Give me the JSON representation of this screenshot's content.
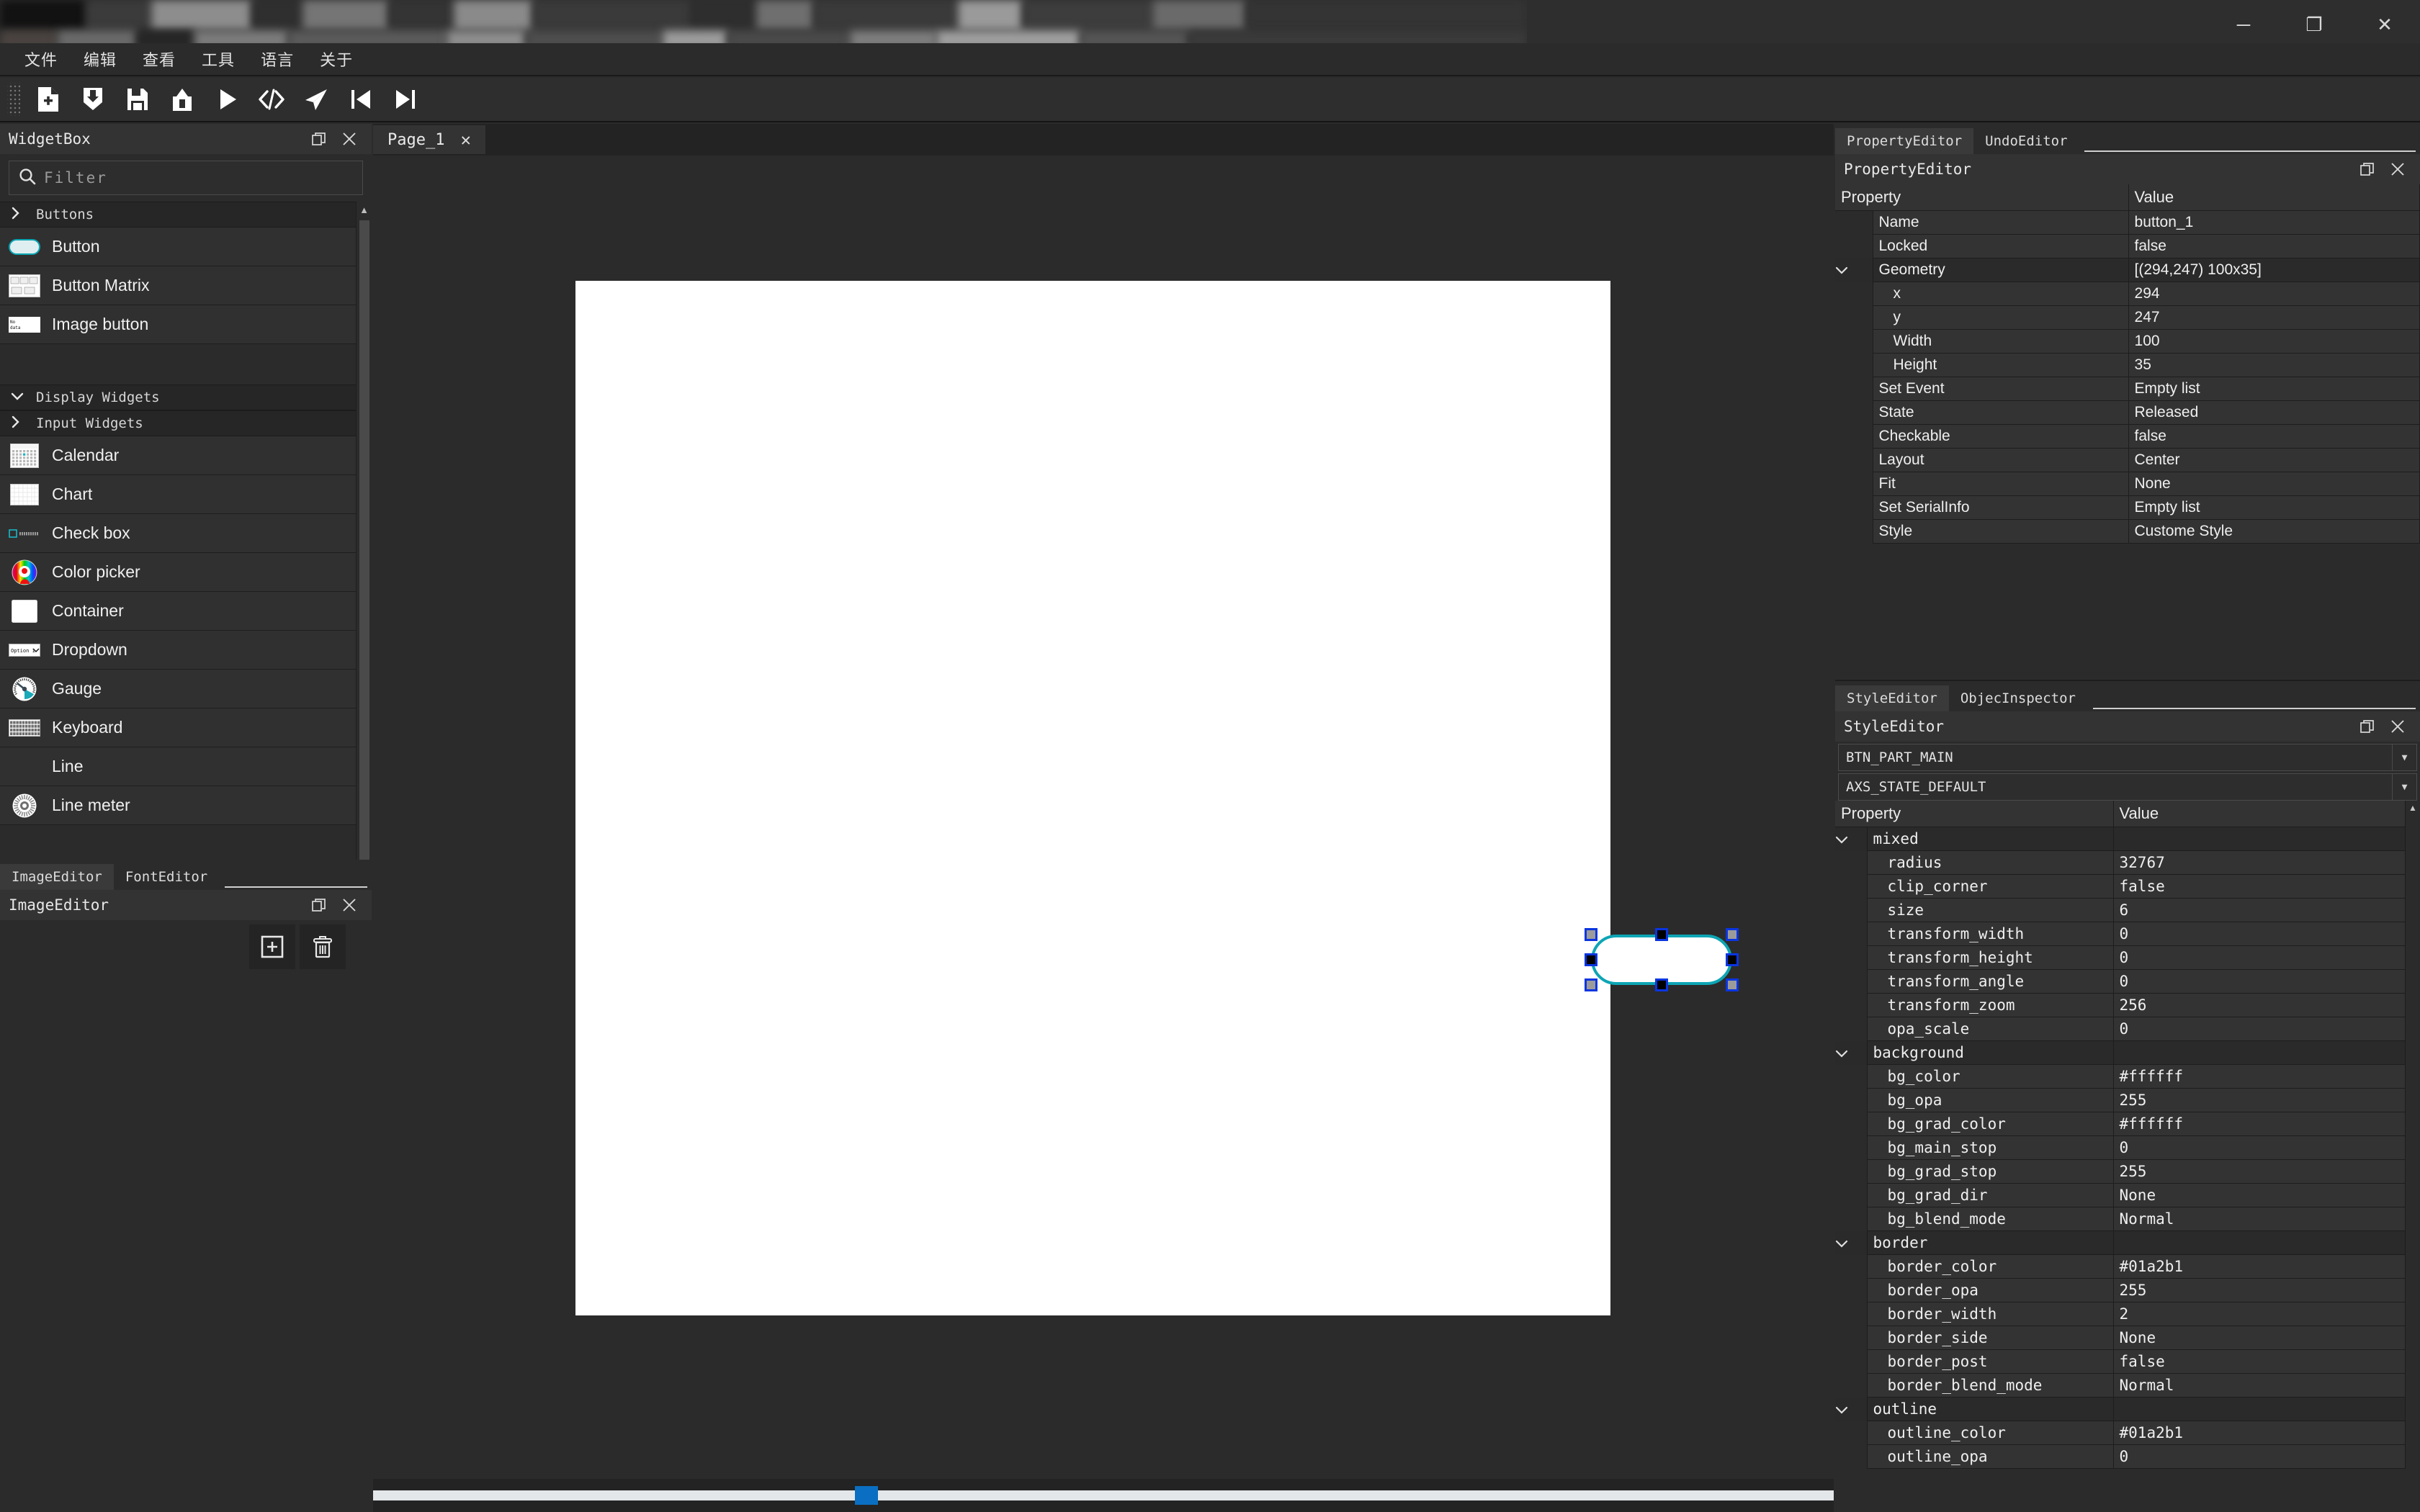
{
  "window": {
    "minimize_label": "─",
    "maximize_label": "❐",
    "close_label": "✕"
  },
  "menubar": {
    "items": [
      {
        "label": "文件",
        "name": "menu-file"
      },
      {
        "label": "编辑",
        "name": "menu-edit"
      },
      {
        "label": "查看",
        "name": "menu-view"
      },
      {
        "label": "工具",
        "name": "menu-tools"
      },
      {
        "label": "语言",
        "name": "menu-language"
      },
      {
        "label": "关于",
        "name": "menu-about"
      }
    ]
  },
  "toolbar": {
    "buttons": [
      {
        "icon": "new-file-icon"
      },
      {
        "icon": "open-file-icon"
      },
      {
        "icon": "save-icon"
      },
      {
        "icon": "export-icon"
      },
      {
        "icon": "run-icon"
      },
      {
        "icon": "code-icon"
      },
      {
        "icon": "send-icon"
      },
      {
        "icon": "prev-page-icon"
      },
      {
        "icon": "next-page-icon"
      }
    ]
  },
  "widgetbox": {
    "panel_title": "WidgetBox",
    "filter_placeholder": "Filter",
    "search_icon": "search-icon",
    "restore_icon": "restore-icon",
    "close_icon": "close-icon",
    "items": [
      {
        "type": "group",
        "label": "Buttons",
        "expanded": false
      },
      {
        "type": "item",
        "label": "Button",
        "icon": "button-icon"
      },
      {
        "type": "item",
        "label": "Button Matrix",
        "icon": "button-matrix-icon"
      },
      {
        "type": "item",
        "label": "Image button",
        "icon": "image-button-icon"
      },
      {
        "type": "spacer"
      },
      {
        "type": "group",
        "label": "Display Widgets",
        "expanded": true
      },
      {
        "type": "group",
        "label": "Input Widgets",
        "expanded": false
      },
      {
        "type": "item",
        "label": "Calendar",
        "icon": "calendar-icon"
      },
      {
        "type": "item",
        "label": "Chart",
        "icon": "chart-icon"
      },
      {
        "type": "item",
        "label": "Check box",
        "icon": "checkbox-icon"
      },
      {
        "type": "item",
        "label": "Color picker",
        "icon": "color-picker-icon"
      },
      {
        "type": "item",
        "label": "Container",
        "icon": "container-icon"
      },
      {
        "type": "item",
        "label": "Dropdown",
        "icon": "dropdown-icon"
      },
      {
        "type": "item",
        "label": "Gauge",
        "icon": "gauge-icon"
      },
      {
        "type": "item",
        "label": "Keyboard",
        "icon": "keyboard-icon"
      },
      {
        "type": "item",
        "label": "Line",
        "icon": "line-icon"
      },
      {
        "type": "item",
        "label": "Line meter",
        "icon": "line-meter-icon"
      }
    ]
  },
  "imageeditor": {
    "tabs": [
      {
        "label": "ImageEditor",
        "active": true
      },
      {
        "label": "FontEditor",
        "active": false
      }
    ],
    "panel_title": "ImageEditor",
    "add_button_icon": "add-image-icon",
    "delete_button_icon": "trash-icon",
    "restore_icon": "restore-icon",
    "close_icon": "close-icon"
  },
  "canvas": {
    "tabs": [
      {
        "label": "Page_1",
        "close_label": "✕",
        "active": true
      }
    ],
    "selected_widget": {
      "name": "button_1",
      "shape": "rounded-rect",
      "border_color": "#0ea5b5",
      "handle_color": "#0b35e0"
    },
    "hscroll_position_pct": 33
  },
  "property_editor": {
    "tabs": [
      {
        "label": "PropertyEditor",
        "active": true
      },
      {
        "label": "UndoEditor",
        "active": false
      }
    ],
    "panel_title": "PropertyEditor",
    "restore_icon": "restore-icon",
    "close_icon": "close-icon",
    "columns": [
      "Property",
      "Value"
    ],
    "rows": [
      {
        "level": 1,
        "label": "Name",
        "value": "button_1",
        "group": false
      },
      {
        "level": 1,
        "label": "Locked",
        "value": "false",
        "group": false
      },
      {
        "level": 1,
        "label": "Geometry",
        "value": "[(294,247) 100x35]",
        "group": true,
        "expanded": true
      },
      {
        "level": 2,
        "label": "x",
        "value": "294",
        "group": false
      },
      {
        "level": 2,
        "label": "y",
        "value": "247",
        "group": false
      },
      {
        "level": 2,
        "label": "Width",
        "value": "100",
        "group": false
      },
      {
        "level": 2,
        "label": "Height",
        "value": "35",
        "group": false
      },
      {
        "level": 1,
        "label": "Set Event",
        "value": "Empty list",
        "group": false
      },
      {
        "level": 1,
        "label": "State",
        "value": "Released",
        "group": false
      },
      {
        "level": 1,
        "label": "Checkable",
        "value": "false",
        "group": false
      },
      {
        "level": 1,
        "label": "Layout",
        "value": "Center",
        "group": false
      },
      {
        "level": 1,
        "label": "Fit",
        "value": "None",
        "group": false
      },
      {
        "level": 1,
        "label": "Set SerialInfo",
        "value": "Empty list",
        "group": false
      },
      {
        "level": 1,
        "label": "Style",
        "value": "Custome Style",
        "group": false
      }
    ]
  },
  "style_editor": {
    "tabs": [
      {
        "label": "StyleEditor",
        "active": true
      },
      {
        "label": "ObjecInspector",
        "active": false
      }
    ],
    "panel_title": "StyleEditor",
    "restore_icon": "restore-icon",
    "close_icon": "close-icon",
    "part_select": "BTN_PART_MAIN",
    "state_select": "AXS_STATE_DEFAULT",
    "columns": [
      "Property",
      "Value"
    ],
    "rows": [
      {
        "level": 1,
        "label": "mixed",
        "value": "",
        "group": true,
        "expanded": true
      },
      {
        "level": 2,
        "label": "radius",
        "value": "32767",
        "group": false
      },
      {
        "level": 2,
        "label": "clip_corner",
        "value": "false",
        "group": false
      },
      {
        "level": 2,
        "label": "size",
        "value": "6",
        "group": false
      },
      {
        "level": 2,
        "label": "transform_width",
        "value": "0",
        "group": false
      },
      {
        "level": 2,
        "label": "transform_height",
        "value": "0",
        "group": false
      },
      {
        "level": 2,
        "label": "transform_angle",
        "value": "0",
        "group": false
      },
      {
        "level": 2,
        "label": "transform_zoom",
        "value": "256",
        "group": false
      },
      {
        "level": 2,
        "label": "opa_scale",
        "value": "0",
        "group": false
      },
      {
        "level": 1,
        "label": "background",
        "value": "",
        "group": true,
        "expanded": true
      },
      {
        "level": 2,
        "label": "bg_color",
        "value": "#ffffff",
        "group": false
      },
      {
        "level": 2,
        "label": "bg_opa",
        "value": "255",
        "group": false
      },
      {
        "level": 2,
        "label": "bg_grad_color",
        "value": "#ffffff",
        "group": false
      },
      {
        "level": 2,
        "label": "bg_main_stop",
        "value": "0",
        "group": false
      },
      {
        "level": 2,
        "label": "bg_grad_stop",
        "value": "255",
        "group": false
      },
      {
        "level": 2,
        "label": "bg_grad_dir",
        "value": "None",
        "group": false
      },
      {
        "level": 2,
        "label": "bg_blend_mode",
        "value": "Normal",
        "group": false
      },
      {
        "level": 1,
        "label": "border",
        "value": "",
        "group": true,
        "expanded": true
      },
      {
        "level": 2,
        "label": "border_color",
        "value": "#01a2b1",
        "group": false
      },
      {
        "level": 2,
        "label": "border_opa",
        "value": "255",
        "group": false
      },
      {
        "level": 2,
        "label": "border_width",
        "value": "2",
        "group": false
      },
      {
        "level": 2,
        "label": "border_side",
        "value": "None",
        "group": false
      },
      {
        "level": 2,
        "label": "border_post",
        "value": "false",
        "group": false
      },
      {
        "level": 2,
        "label": "border_blend_mode",
        "value": "Normal",
        "group": false
      },
      {
        "level": 1,
        "label": "outline",
        "value": "",
        "group": true,
        "expanded": true
      },
      {
        "level": 2,
        "label": "outline_color",
        "value": "#01a2b1",
        "group": false
      },
      {
        "level": 2,
        "label": "outline_opa",
        "value": "0",
        "group": false
      }
    ]
  },
  "colors": {
    "accent": "#01a2b1",
    "selection_handle": "#0b35e0",
    "scrollbar_thumb": "#0a6fc2",
    "panel_bg": "#2b2b2b",
    "row_bg": "#333333"
  }
}
